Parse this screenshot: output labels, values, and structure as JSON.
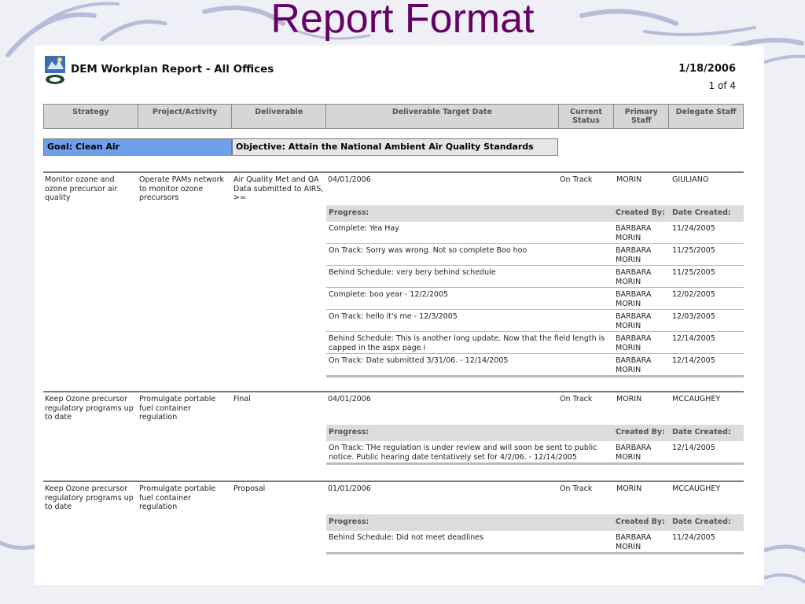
{
  "slide_title": "Report Format",
  "report": {
    "title": "DEM Workplan Report - All Offices",
    "date": "1/18/2006",
    "page": "1 of 4",
    "columns": [
      "Strategy",
      "Project/Activity",
      "Deliverable",
      "Deliverable Target Date",
      "Current Status",
      "Primary Staff",
      "Delegate Staff"
    ],
    "goal": "Goal: Clean Air",
    "objective": "Objective: Attain the National Ambient Air Quality Standards",
    "progress_header": {
      "progress": "Progress:",
      "created_by": "Created By:",
      "date_created": "Date Created:"
    },
    "entries": [
      {
        "strategy": "Monitor ozone and ozone precursor air quality",
        "project": "Operate PAMs network to monitor ozone precursors",
        "deliverable": "Air Quality Met and QA Data submitted to AIRS, >=",
        "target_date": "04/01/2006",
        "status": "On Track",
        "primary": "MORIN",
        "delegate": "GIULIANO",
        "progress": [
          {
            "text": "Complete: Yea Hay",
            "by": "BARBARA MORIN",
            "date": "11/24/2005"
          },
          {
            "text": "On Track: Sorry was wrong.  Not so complete Boo hoo",
            "by": "BARBARA MORIN",
            "date": "11/25/2005"
          },
          {
            "text": "Behind Schedule: very bery behind schedule",
            "by": "BARBARA MORIN",
            "date": "11/25/2005"
          },
          {
            "text": "Complete: boo year - 12/2/2005",
            "by": "BARBARA MORIN",
            "date": "12/02/2005"
          },
          {
            "text": "On Track: hello it's me - 12/3/2005",
            "by": "BARBARA MORIN",
            "date": "12/03/2005"
          },
          {
            "text": "Behind Schedule: This is another long update. Now that the field length is capped in the aspx page i",
            "by": "BARBARA MORIN",
            "date": "12/14/2005"
          },
          {
            "text": "On Track: Date submitted 3/31/06. - 12/14/2005",
            "by": "BARBARA MORIN",
            "date": "12/14/2005"
          }
        ]
      },
      {
        "strategy": "Keep Ozone precursor regulatory programs up to date",
        "project": "Promulgate portable fuel container regulation",
        "deliverable": "Final",
        "target_date": "04/01/2006",
        "status": "On Track",
        "primary": "MORIN",
        "delegate": "MCCAUGHEY",
        "progress": [
          {
            "text": "On Track: THe regulation is under review and will soon be sent to public notice. Public hearing date tentatively set for 4/2/06. - 12/14/2005",
            "by": "BARBARA MORIN",
            "date": "12/14/2005"
          }
        ]
      },
      {
        "strategy": "Keep Ozone precursor regulatory programs up to date",
        "project": "Promulgate portable fuel container regulation",
        "deliverable": "Proposal",
        "target_date": "01/01/2006",
        "status": "On Track",
        "primary": "MORIN",
        "delegate": "MCCAUGHEY",
        "progress": [
          {
            "text": "Behind Schedule: Did not meet deadlines",
            "by": "BARBARA MORIN",
            "date": "11/24/2005"
          }
        ]
      }
    ]
  },
  "colors": {
    "title": "#660066",
    "goal_bg": "#6fa0ec",
    "header_bg": "#d6d6d6",
    "progress_header_bg": "#dcdcdc"
  }
}
